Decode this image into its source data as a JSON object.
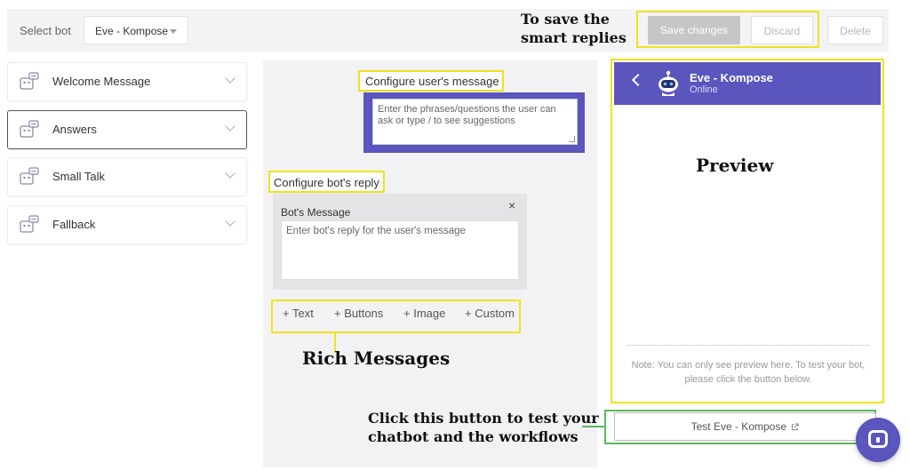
{
  "header": {
    "select_label": "Select bot",
    "bot_selected": "Eve - Kompose",
    "save_label": "Save changes",
    "discard_label": "Discard",
    "delete_label": "Delete"
  },
  "annotations": {
    "save_note": "To save the smart replies",
    "rich_note": "Rich Messages",
    "preview_note": "Preview",
    "test_note": "Click this button to test your chatbot and the workflows"
  },
  "sidebar": {
    "items": [
      {
        "label": "Welcome Message"
      },
      {
        "label": "Answers"
      },
      {
        "label": "Small Talk"
      },
      {
        "label": "Fallback"
      }
    ]
  },
  "editor": {
    "user_message_label": "Configure user's message",
    "user_message_placeholder": "Enter the phrases/questions the user can ask or type / to see suggestions",
    "bot_reply_label": "Configure bot's reply",
    "bot_message_title": "Bot's Message",
    "bot_message_placeholder": "Enter bot's reply for the user's message",
    "close_symbol": "×",
    "rich_options": [
      "+ Text",
      "+ Buttons",
      "+ Image",
      "+ Custom"
    ]
  },
  "preview": {
    "bot_name": "Eve - Kompose",
    "status": "Online",
    "note": "Note: You can only see preview here. To test your bot, please click the button below.",
    "test_button": "Test Eve - Kompose"
  },
  "colors": {
    "accent": "#5b55be",
    "highlight_yellow": "#f2e21c",
    "highlight_green": "#5cb85c"
  }
}
